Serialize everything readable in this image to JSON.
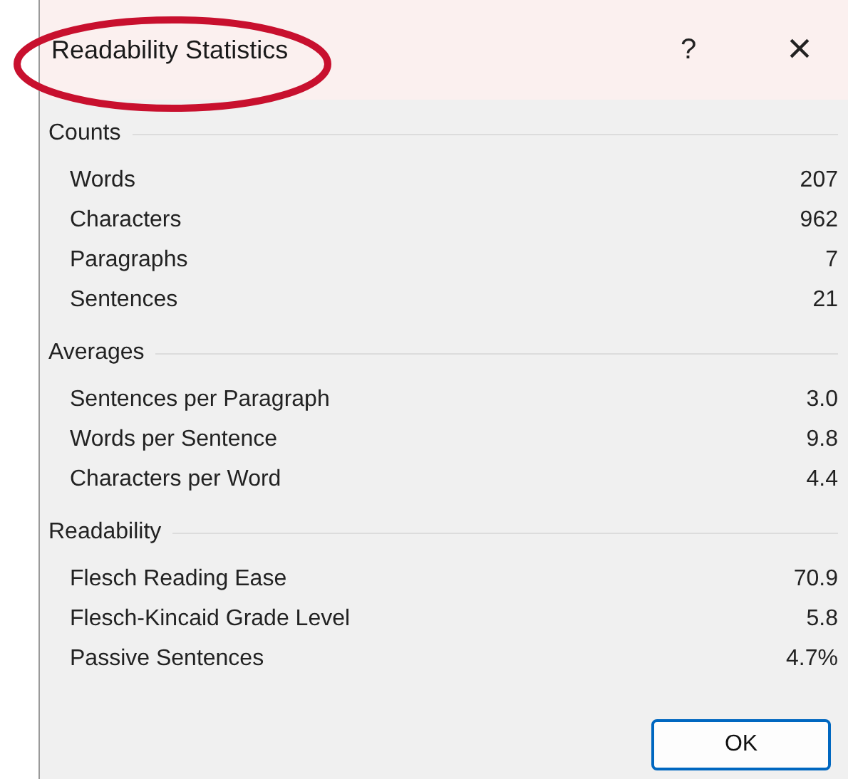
{
  "window": {
    "title": "Readability Statistics",
    "help": "?",
    "close": "×"
  },
  "sections": [
    {
      "title": "Counts",
      "rows": [
        {
          "label": "Words",
          "value": "207"
        },
        {
          "label": "Characters",
          "value": "962"
        },
        {
          "label": "Paragraphs",
          "value": "7"
        },
        {
          "label": "Sentences",
          "value": "21"
        }
      ]
    },
    {
      "title": "Averages",
      "rows": [
        {
          "label": "Sentences per Paragraph",
          "value": "3.0"
        },
        {
          "label": "Words per Sentence",
          "value": "9.8"
        },
        {
          "label": "Characters per Word",
          "value": "4.4"
        }
      ]
    },
    {
      "title": "Readability",
      "rows": [
        {
          "label": "Flesch Reading Ease",
          "value": "70.9"
        },
        {
          "label": "Flesch-Kincaid Grade Level",
          "value": "5.8"
        },
        {
          "label": "Passive Sentences",
          "value": "4.7%"
        }
      ]
    }
  ],
  "buttons": [
    "OK"
  ]
}
